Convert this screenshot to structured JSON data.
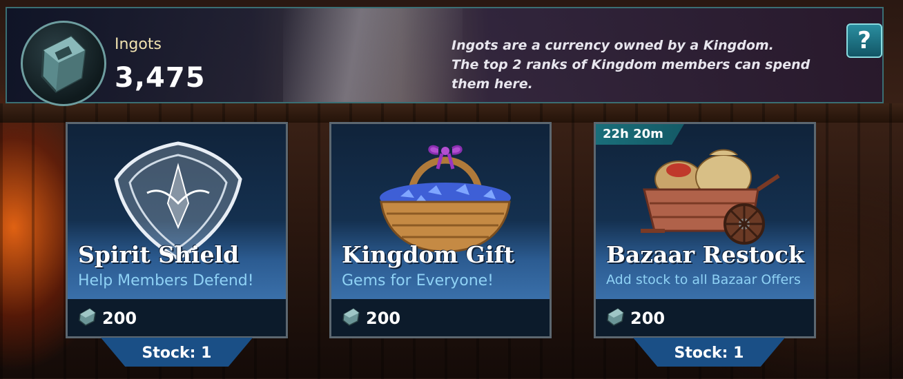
{
  "header": {
    "currency_name": "Ingots",
    "currency_amount": "3,475",
    "info_line1": "Ingots are a currency owned by a Kingdom.",
    "info_line2": "The top 2 ranks of Kingdom members can spend",
    "info_line3": "them here.",
    "help_label": "?"
  },
  "cards": [
    {
      "title": "Spirit Shield",
      "subtitle": "Help Members Defend!",
      "price": "200",
      "stock": "Stock: 1",
      "icon": "spirit-shield-icon"
    },
    {
      "title": "Kingdom Gift",
      "subtitle": "Gems for Everyone!",
      "price": "200",
      "icon": "gem-basket-icon"
    },
    {
      "title": "Bazaar Restock",
      "subtitle": "Add stock to all Bazaar Offers",
      "price": "200",
      "stock": "Stock: 1",
      "timer": "22h 20m",
      "icon": "bazaar-cart-icon"
    }
  ],
  "colors": {
    "accent": "#1a4f86",
    "subtitle": "#8fd2f5",
    "border": "#3a6f74"
  }
}
